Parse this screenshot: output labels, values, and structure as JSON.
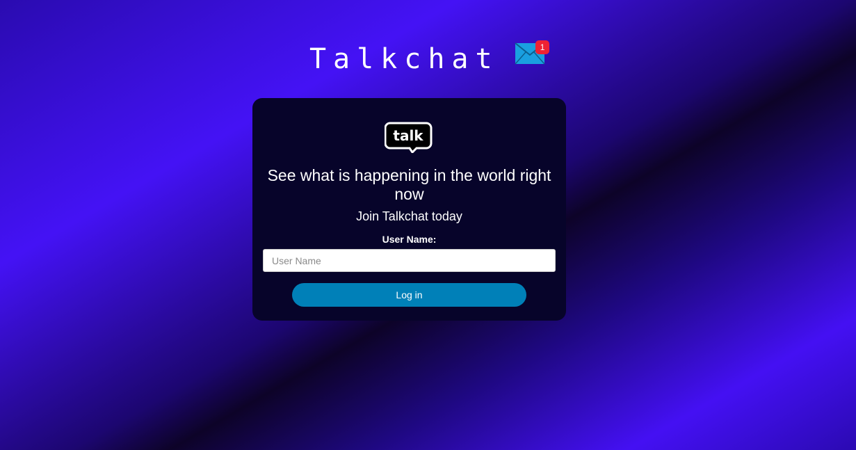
{
  "header": {
    "app_title": "Talkchat",
    "mail_icon": "mail-envelope-icon",
    "notification_count": "1",
    "badge_color": "#ee2233",
    "mail_color": "#1a9fe0"
  },
  "card": {
    "logo_text": "talk",
    "headline": "See what is happening in the world right now",
    "subheadline": "Join Talkchat today",
    "username": {
      "label": "User Name:",
      "placeholder": "User Name",
      "value": ""
    },
    "login_label": "Log in",
    "button_color": "#0080b8"
  }
}
